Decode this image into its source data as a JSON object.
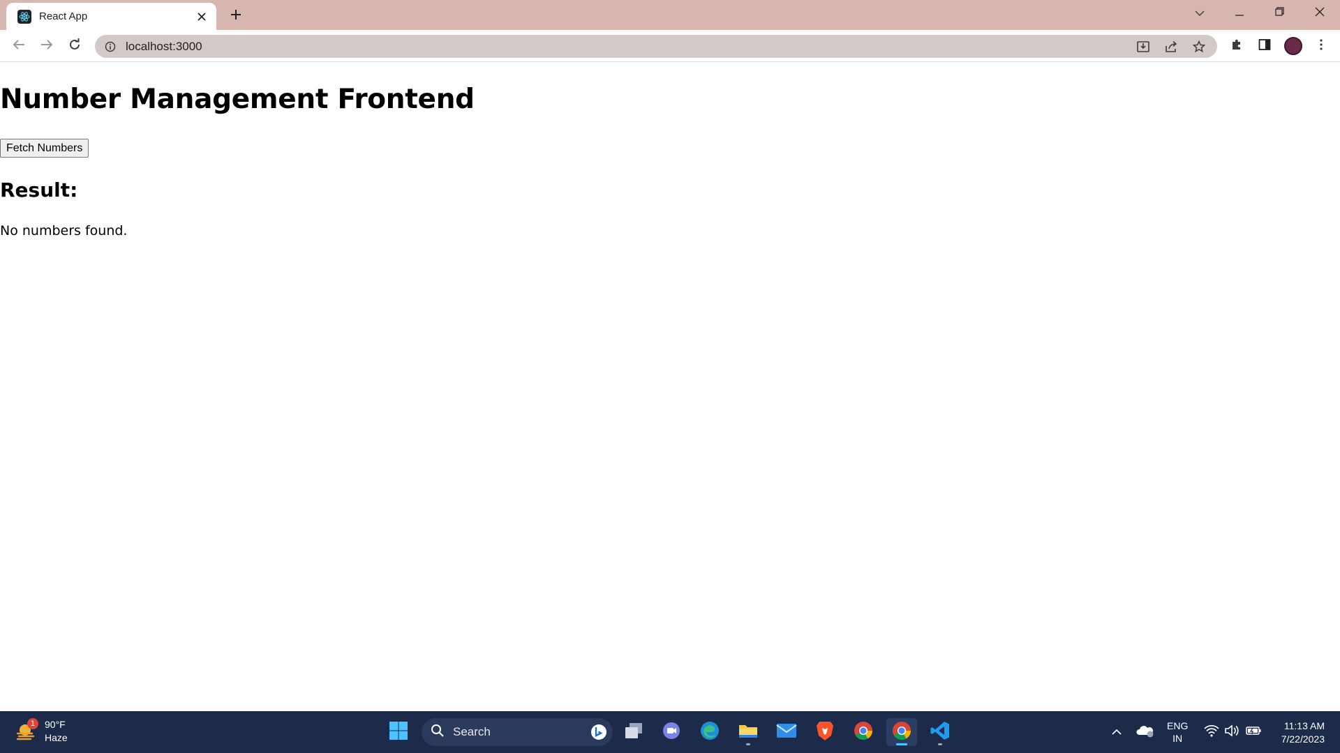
{
  "browser": {
    "tab_title": "React App",
    "url": "localhost:3000",
    "icons": {
      "favicon": "react-logo-icon",
      "tab_close": "close-icon",
      "new_tab": "plus-icon",
      "tab_search": "chevron-down-icon",
      "minimize": "minimize-icon",
      "restore": "restore-icon",
      "close_window": "close-icon",
      "back": "arrow-left-icon",
      "forward": "arrow-right-icon",
      "reload": "reload-icon",
      "site_info": "info-icon",
      "install": "install-icon",
      "share": "share-icon",
      "bookmark": "star-icon",
      "extensions": "puzzle-icon",
      "side_panel": "side-panel-icon",
      "menu": "kebab-menu-icon"
    }
  },
  "page": {
    "title": "Number Management Frontend",
    "fetch_button_label": "Fetch Numbers",
    "result_heading": "Result:",
    "result_text": "No numbers found."
  },
  "taskbar": {
    "weather": {
      "temperature": "90°F",
      "condition": "Haze",
      "badge_count": "1"
    },
    "search_label": "Search",
    "apps": [
      "windows-start",
      "search",
      "task-view",
      "teams",
      "edge",
      "file-explorer",
      "mail",
      "brave",
      "chrome",
      "chrome",
      "vscode"
    ],
    "tray": {
      "language_line1": "ENG",
      "language_line2": "IN"
    },
    "clock": {
      "time": "11:13 AM",
      "date": "7/22/2023"
    }
  },
  "colors": {
    "chrome_frame": "#d6b6ae",
    "omnibox": "#d3c9c6",
    "taskbar": "#1c2b4a",
    "active_indicator": "#4cc2ff"
  }
}
